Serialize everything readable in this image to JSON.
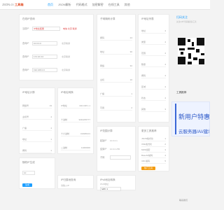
{
  "header": {
    "logo_prefix": "JSON.cn",
    "logo_mark": "工具箱",
    "nav": [
      "首页",
      "JSON解析",
      "代码格式",
      "加密解密",
      "在线工具",
      "其他"
    ]
  },
  "ip_tool": {
    "title": "在线IP查询",
    "lookup_label": "当前IP",
    "lookup_value": "IP地址结果",
    "lookup_result": "电信 北京 联通",
    "rows": [
      {
        "label": "查询IP",
        "value": "10.0.0.0",
        "note": "北京联通"
      },
      {
        "label": "查询IP",
        "value": "172.16.0.0",
        "note": "北京联通"
      },
      {
        "label": "查询IP",
        "value": "192.168.0.0",
        "note": "北京联通"
      }
    ]
  },
  "cidr": {
    "title": "IP地址计算",
    "rows": [
      {
        "label": "网络号",
        "value": "19"
      },
      {
        "label": "主机号",
        "value": "4"
      },
      {
        "label": "广播",
        "value": "4"
      },
      {
        "label": "地址",
        "value": "1"
      },
      {
        "label": "掩码",
        "value": "1"
      }
    ]
  },
  "mask_calc": {
    "title": "子网掩码计算",
    "rows": [
      {
        "label": "掩码",
        "value": "24"
      },
      {
        "label": "地址",
        "value": "30"
      },
      {
        "label": "网络",
        "value": "32"
      },
      {
        "label": "主机",
        "value": "16"
      },
      {
        "label": "广播",
        "value": "1"
      },
      {
        "label": "可用",
        "value": "2"
      }
    ]
  },
  "convert_tool": {
    "title": "IP地址转换",
    "rows": [
      {
        "label": "IP地址",
        "value": "192.168.1.1"
      },
      {
        "label": "十进制",
        "value": "3232235777"
      },
      {
        "label": "十六进制",
        "value": "C0A80101"
      },
      {
        "label": "二进制",
        "value": "11000000"
      }
    ]
  },
  "ip_list": {
    "title": "IP地址列表",
    "rows": [
      {
        "label": "地址",
        "value": "4"
      },
      {
        "label": "类型",
        "value": "4"
      },
      {
        "label": "范围",
        "value": "4"
      },
      {
        "label": "数量",
        "value": "4"
      },
      {
        "label": "掩码",
        "value": "4"
      },
      {
        "label": "区域",
        "value": "4"
      },
      {
        "label": "状态",
        "value": "4"
      },
      {
        "label": "其他",
        "value": "3"
      }
    ]
  },
  "qr_block": {
    "title": "扫码关注",
    "line1": "关注公众号获取更多工具",
    "line2": "工具推荐"
  },
  "ad": {
    "line1": "新用户特惠专",
    "line2": "云服务器/AI/建站"
  },
  "more_tools": {
    "title": "更多工具推荐",
    "items": [
      {
        "label": "JSON格式化",
        "value": "1"
      },
      {
        "label": "XML格式化",
        "value": "2"
      },
      {
        "label": "MD5加密",
        "value": "3"
      },
      {
        "label": "Base64编码",
        "value": "4"
      },
      {
        "label": "URL编码",
        "value": "5"
      },
      {
        "label": "时间戳转换",
        "value": "6"
      }
    ],
    "highlight": "热门工具"
  },
  "range_tool": {
    "title": "IP范围计算",
    "rows": [
      {
        "label": "起始IP",
        "value": "10.0.0.1"
      },
      {
        "label": "结束IP",
        "value": "10.0.0.255"
      }
    ],
    "select_label": "子网"
  },
  "bottom_left": {
    "title": "随机IP生成",
    "input": "10",
    "button": "生成"
  },
  "bottom_mid": {
    "title": "IP归属地查询",
    "input": "请输入IP"
  },
  "bottom_right": {
    "title": "IPv6地址转换",
    "label": "IPv6地址",
    "input": "fe80::1"
  },
  "feedback": "联系我们"
}
